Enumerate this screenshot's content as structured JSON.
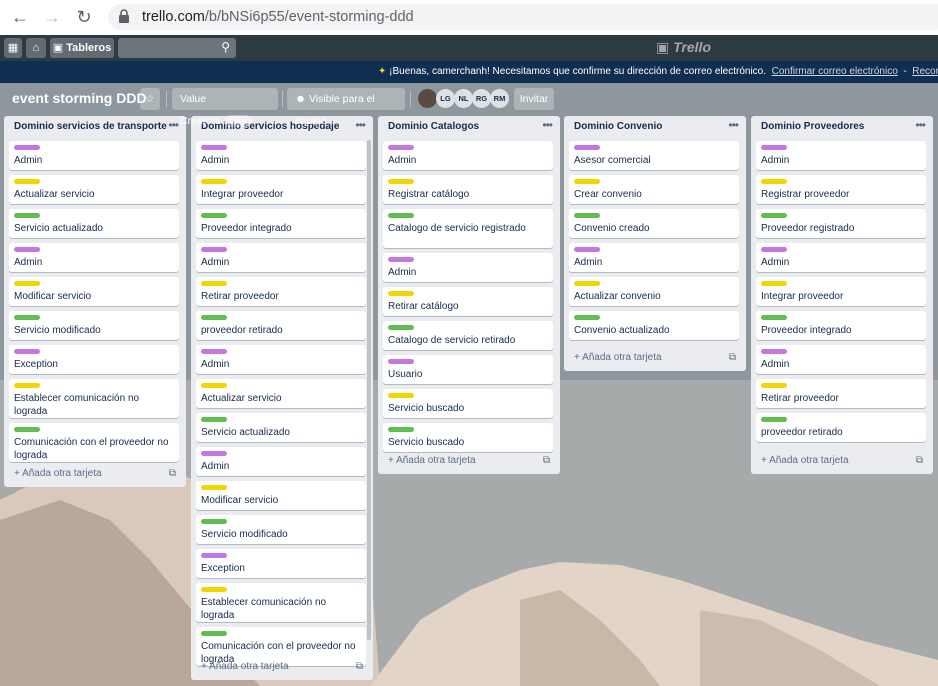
{
  "browser": {
    "url_host": "trello.com",
    "url_path": "/b/bNSi6p55/event-storming-ddd",
    "back_icon": "arrow-left-icon",
    "forward_icon": "arrow-right-icon",
    "reload_icon": "reload-icon"
  },
  "header": {
    "boards_label": "Tableros",
    "logo_text": "Trello"
  },
  "notification": {
    "message": "¡Buenas, camerchanh! Necesitamos que confirme su dirección de correo electrónico.",
    "confirm_link": "Confirmar correo electrónico",
    "separator": "-",
    "remind_link": "Recordármelo m"
  },
  "board": {
    "title": "event storming DDD",
    "team_label": "Value Creators",
    "free_badge": "Free",
    "visibility_label": "Visible para el equipo",
    "members": [
      "LG",
      "NL",
      "RG",
      "RM"
    ],
    "invite_label": "Invitar"
  },
  "colors": {
    "purple": "#c377e0",
    "yellow": "#f2d600",
    "green": "#61bd4f"
  },
  "lists": [
    {
      "title": "Dominio servicios de transporte",
      "add_label": "Añada otra tarjeta",
      "cards": [
        {
          "label": "purple",
          "text": "Admin"
        },
        {
          "label": "yellow",
          "text": "Actualizar servicio"
        },
        {
          "label": "green",
          "text": "Servicio actualizado"
        },
        {
          "label": "purple",
          "text": "Admin"
        },
        {
          "label": "yellow",
          "text": "Modificar servicio"
        },
        {
          "label": "green",
          "text": "Servicio modificado"
        },
        {
          "label": "purple",
          "text": "Exception"
        },
        {
          "label": "yellow",
          "text": "Establecer comunicación no lograda"
        },
        {
          "label": "green",
          "text": "Comunicación con el proveedor no lograda"
        }
      ]
    },
    {
      "title": "Dominio servicios hospedaje",
      "add_label": "Añada otra tarjeta",
      "cards": [
        {
          "label": "purple",
          "text": "Admin"
        },
        {
          "label": "yellow",
          "text": "Integrar proveedor"
        },
        {
          "label": "green",
          "text": "Proveedor integrado"
        },
        {
          "label": "purple",
          "text": "Admin"
        },
        {
          "label": "yellow",
          "text": "Retirar proveedor"
        },
        {
          "label": "green",
          "text": "proveedor retirado"
        },
        {
          "label": "purple",
          "text": "Admin"
        },
        {
          "label": "yellow",
          "text": "Actualizar servicio"
        },
        {
          "label": "green",
          "text": "Servicio actualizado"
        },
        {
          "label": "purple",
          "text": "Admin"
        },
        {
          "label": "yellow",
          "text": "Modificar servicio"
        },
        {
          "label": "green",
          "text": "Servicio modificado"
        },
        {
          "label": "purple",
          "text": "Exception"
        },
        {
          "label": "yellow",
          "text": "Establecer comunicación no lograda"
        },
        {
          "label": "green",
          "text": "Comunicación con el proveedor no lograda"
        }
      ]
    },
    {
      "title": "Dominio Catalogos",
      "add_label": "Añada otra tarjeta",
      "cards": [
        {
          "label": "purple",
          "text": "Admin"
        },
        {
          "label": "yellow",
          "text": "Registrar catálogo"
        },
        {
          "label": "green",
          "text": "Catalogo de servicio registrado"
        },
        {
          "label": "purple",
          "text": "Admin"
        },
        {
          "label": "yellow",
          "text": "Retirar catálogo"
        },
        {
          "label": "green",
          "text": "Catalogo de servicio retirado"
        },
        {
          "label": "purple",
          "text": "Usuario"
        },
        {
          "label": "yellow",
          "text": "Servicio buscado"
        },
        {
          "label": "green",
          "text": "Servicio buscado"
        }
      ]
    },
    {
      "title": "Dominio Convenio",
      "add_label": "Añada otra tarjeta",
      "cards": [
        {
          "label": "purple",
          "text": "Asesor comercial"
        },
        {
          "label": "yellow",
          "text": "Crear convenio"
        },
        {
          "label": "green",
          "text": "Convenio creado"
        },
        {
          "label": "purple",
          "text": "Admin"
        },
        {
          "label": "yellow",
          "text": "Actualizar convenio"
        },
        {
          "label": "green",
          "text": "Convenio actualizado"
        }
      ]
    },
    {
      "title": "Dominio Proveedores",
      "add_label": "Añada otra tarjeta",
      "cards": [
        {
          "label": "purple",
          "text": "Admin"
        },
        {
          "label": "yellow",
          "text": "Registrar proveedor"
        },
        {
          "label": "green",
          "text": "Proveedor registrado"
        },
        {
          "label": "purple",
          "text": "Admin"
        },
        {
          "label": "yellow",
          "text": "Integrar proveedor"
        },
        {
          "label": "green",
          "text": "Proveedor integrado"
        },
        {
          "label": "purple",
          "text": "Admin"
        },
        {
          "label": "yellow",
          "text": "Retirar proveedor"
        },
        {
          "label": "green",
          "text": "proveedor retirado"
        }
      ]
    }
  ]
}
